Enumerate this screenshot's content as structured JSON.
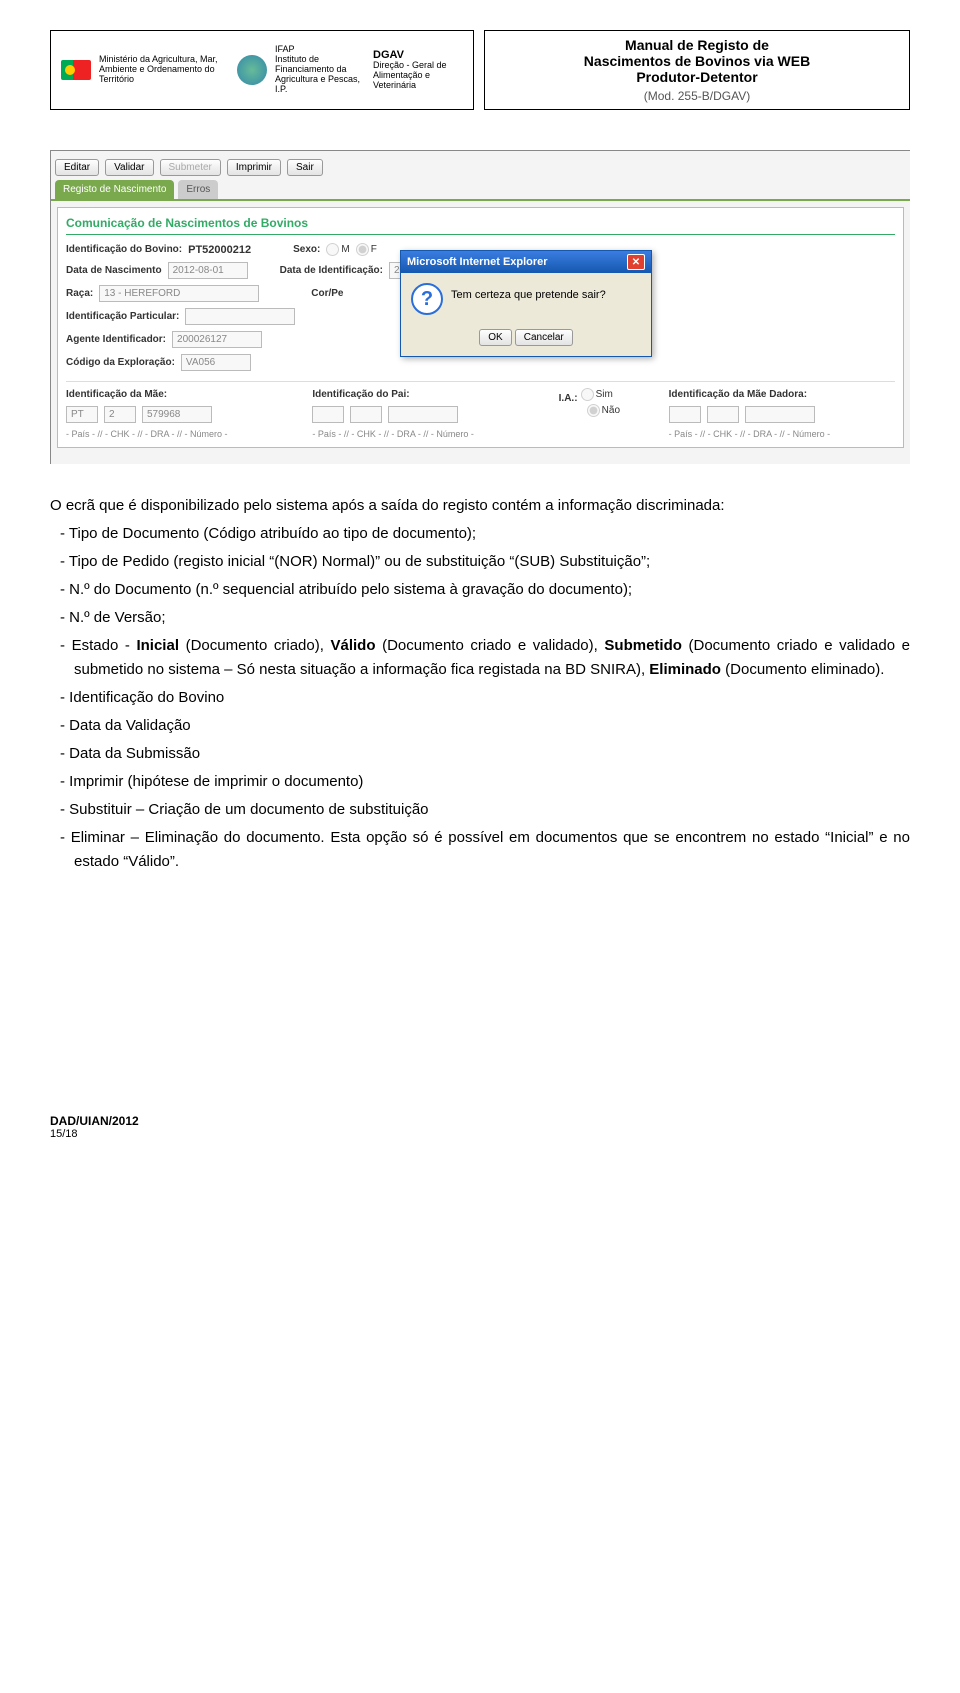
{
  "header": {
    "ministry": "Ministério da Agricultura, Mar, Ambiente e Ordenamento do Território",
    "ifap": "IFAP\nInstituto de Financiamento da Agricultura e Pescas, I.P.",
    "dgav_bold": "DGAV",
    "dgav": "Direção - Geral de Alimentação e Veterinária",
    "title1": "Manual de Registo de",
    "title2": "Nascimentos de Bovinos via WEB",
    "title3": "Produtor-Detentor",
    "mod": "(Mod. 255-B/DGAV)"
  },
  "app": {
    "toolbar": {
      "editar": "Editar",
      "validar": "Validar",
      "submeter": "Submeter",
      "imprimir": "Imprimir",
      "sair": "Sair"
    },
    "tabs": {
      "registo": "Registo de Nascimento",
      "erros": "Erros"
    },
    "panel_title": "Comunicação de Nascimentos de Bovinos",
    "labels": {
      "ident_bovino": "Identificação do Bovino:",
      "ident_bovino_v": "PT52000212",
      "sexo": "Sexo:",
      "m": "M",
      "f": "F",
      "data_nasc": "Data de Nascimento",
      "data_nasc_v": "2012-08-01",
      "data_ident": "Data de Identificação:",
      "data_ident_v": "2012-",
      "raca": "Raça:",
      "raca_v": "13 - HEREFORD",
      "corpe": "Cor/Pe",
      "ident_part": "Identificação Particular:",
      "agente": "Agente Identificador:",
      "agente_v": "200026127",
      "codigo": "Código da Exploração:",
      "codigo_v": "VA056",
      "ident_mae": "Identificação da Mãe:",
      "ident_pai": "Identificação do Pai:",
      "ident_mae_dad": "Identificação da Mãe Dadora:",
      "mae_pais": "PT",
      "mae_chk": "2",
      "mae_num": "579968",
      "ia": "I.A.:",
      "sim": "Sim",
      "nao": "Não",
      "hint": "- País - // - CHK - // - DRA - // - Número -"
    },
    "dialog": {
      "title": "Microsoft Internet Explorer",
      "msg": "Tem certeza que pretende sair?",
      "ok": "OK",
      "cancel": "Cancelar"
    }
  },
  "body": {
    "p0": "O ecrã que é disponibilizado pelo sistema após a saída do registo contém a informação discriminada:",
    "li1": "- Tipo de Documento (Código atribuído ao tipo de documento);",
    "li2": "- Tipo de Pedido (registo inicial “(NOR) Normal)” ou de substituição “(SUB) Substituição”;",
    "li3": "- N.º do Documento (n.º sequencial atribuído pelo sistema à gravação do documento);",
    "li4": "- N.º de Versão;",
    "li5a": "- Estado - ",
    "li5b": "Inicial",
    "li5c": " (Documento criado), ",
    "li5d": "Válido",
    "li5e": " (Documento criado e validado), ",
    "li5f": "Submetido",
    "li5g": " (Documento criado e validado e submetido no sistema – Só nesta situação a informação fica registada na BD SNIRA), ",
    "li5h": "Eliminado",
    "li5i": " (Documento eliminado).",
    "li6": "- Identificação do Bovino",
    "li7": "- Data da Validação",
    "li8": "- Data da Submissão",
    "li9": "- Imprimir (hipótese de imprimir o documento)",
    "li10": "- Substituir – Criação de um documento de substituição",
    "li11": "- Eliminar – Eliminação do documento. Esta opção só é possível em documentos que se encontrem no estado “Inicial” e no estado “Válido”."
  },
  "footer": {
    "org": "DAD/UIAN/2012",
    "page": "15/18"
  }
}
